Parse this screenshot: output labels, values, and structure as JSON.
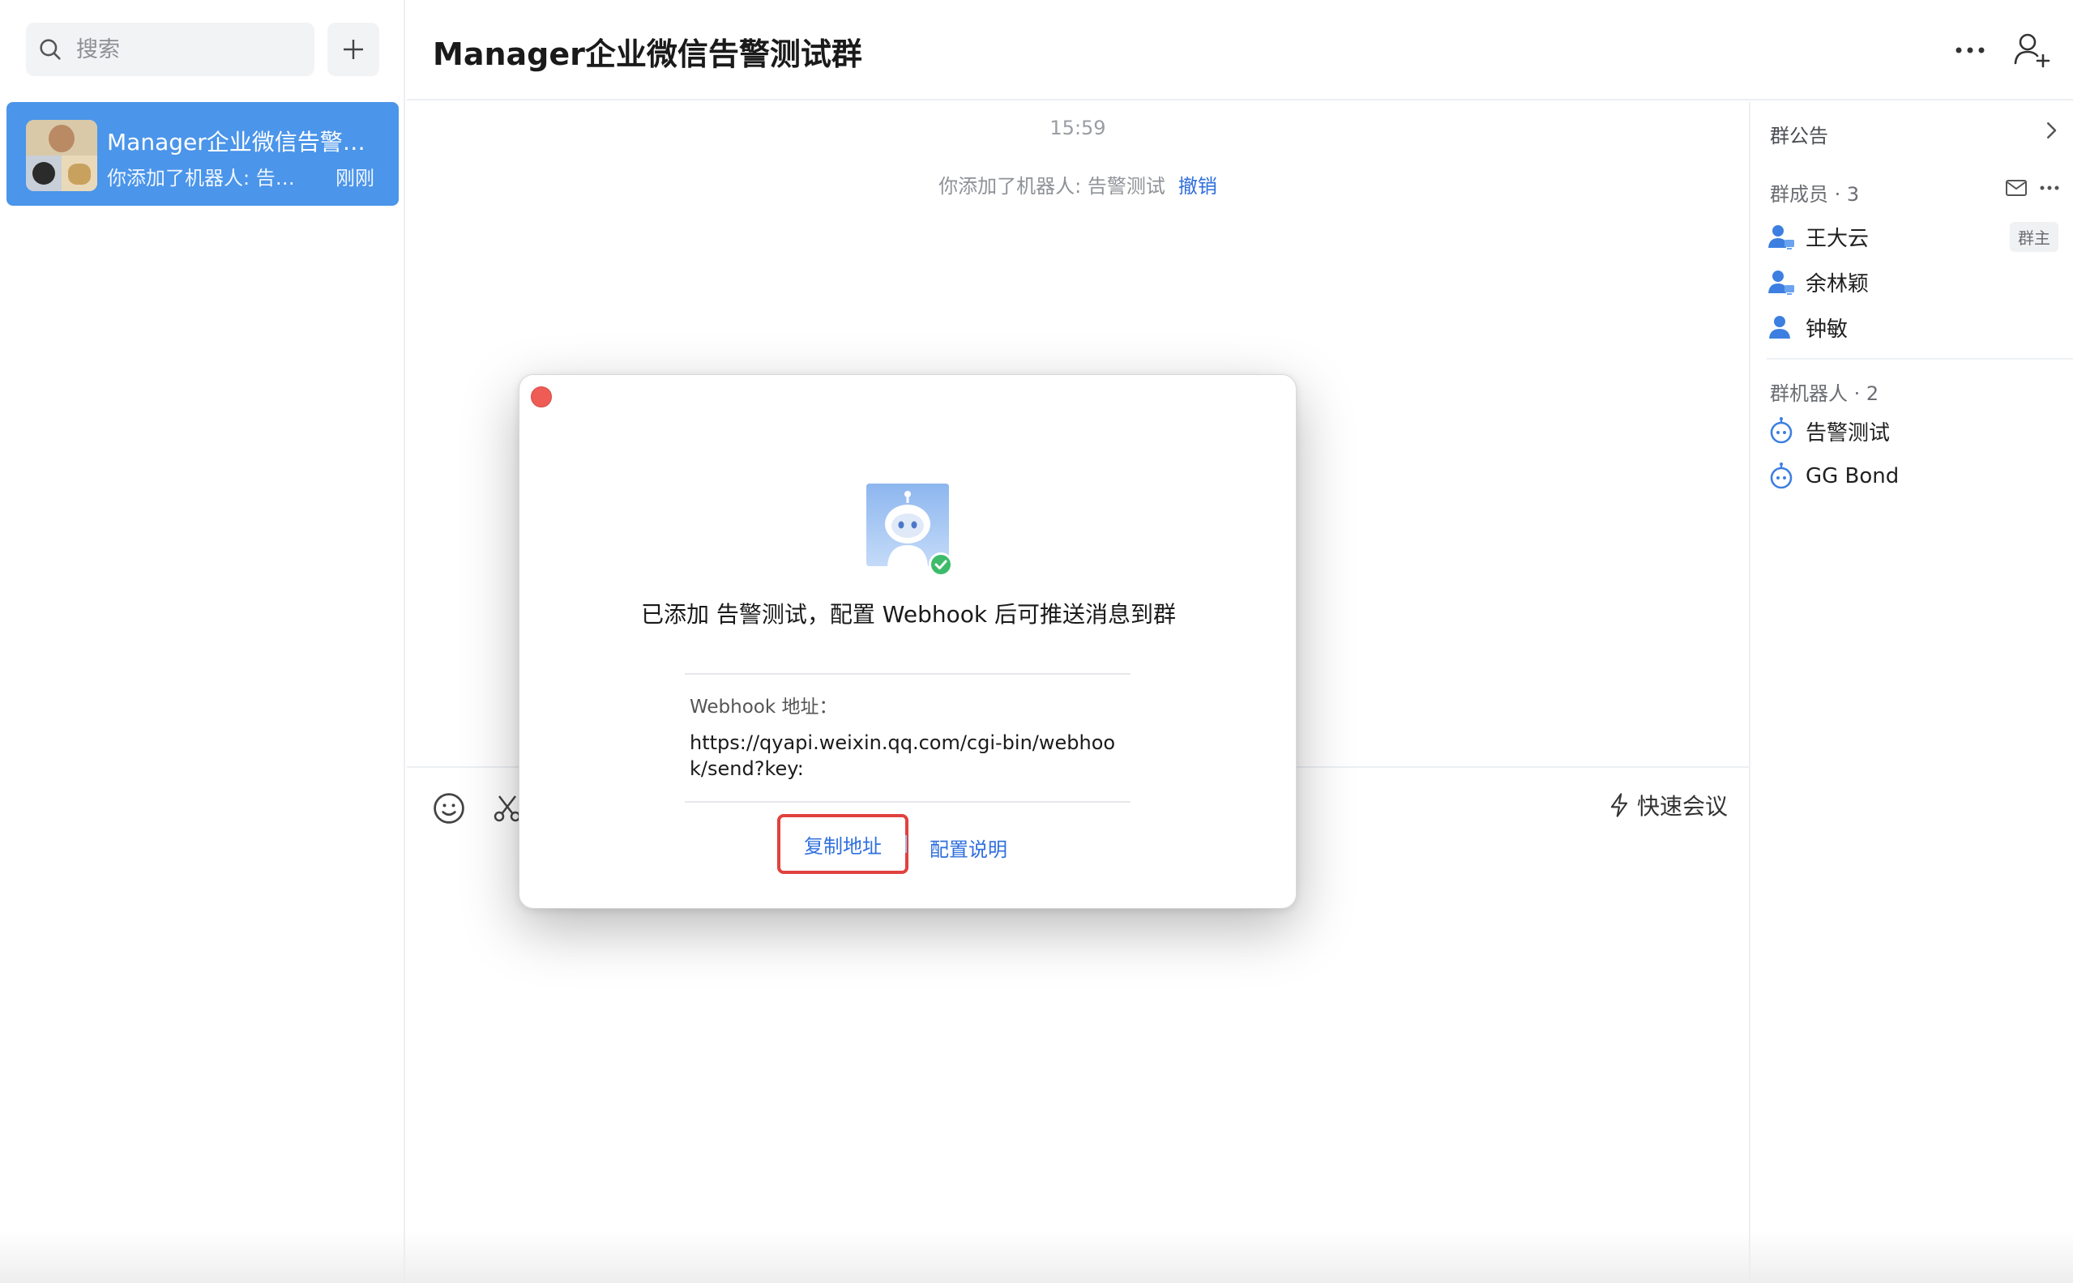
{
  "sidebar": {
    "search_placeholder": "搜索",
    "conversation": {
      "title": "Manager企业微信告警测试群",
      "preview": "你添加了机器人: 告警测试",
      "time": "刚刚"
    }
  },
  "header": {
    "title": "Manager企业微信告警测试群"
  },
  "chat": {
    "timestamp": "15:59",
    "system_message": "你添加了机器人: 告警测试",
    "undo_label": "撤销"
  },
  "composer": {
    "quick_meeting_label": "快速会议"
  },
  "right_panel": {
    "notice_label": "群公告",
    "members_title": "群成员 · 3",
    "members": [
      {
        "name": "王大云",
        "tag": "群主"
      },
      {
        "name": "余林颖",
        "tag": ""
      },
      {
        "name": "钟敏",
        "tag": ""
      }
    ],
    "robots_title": "群机器人 · 2",
    "robots": [
      {
        "name": "告警测试"
      },
      {
        "name": "GG Bond"
      }
    ]
  },
  "dialog": {
    "message": "已添加 告警测试，配置 Webhook 后可推送消息到群",
    "webhook_label": "Webhook 地址：",
    "webhook_url": "https://qyapi.weixin.qq.com/cgi-bin/webhook/send?key:",
    "copy_label": "复制地址",
    "doc_label": "配置说明"
  },
  "colors": {
    "accent": "#2f6fde",
    "selected_conversation": "#4b95ea",
    "highlight_border": "#e0423e",
    "close_button": "#ee5c55",
    "success": "#3dbb6a"
  }
}
